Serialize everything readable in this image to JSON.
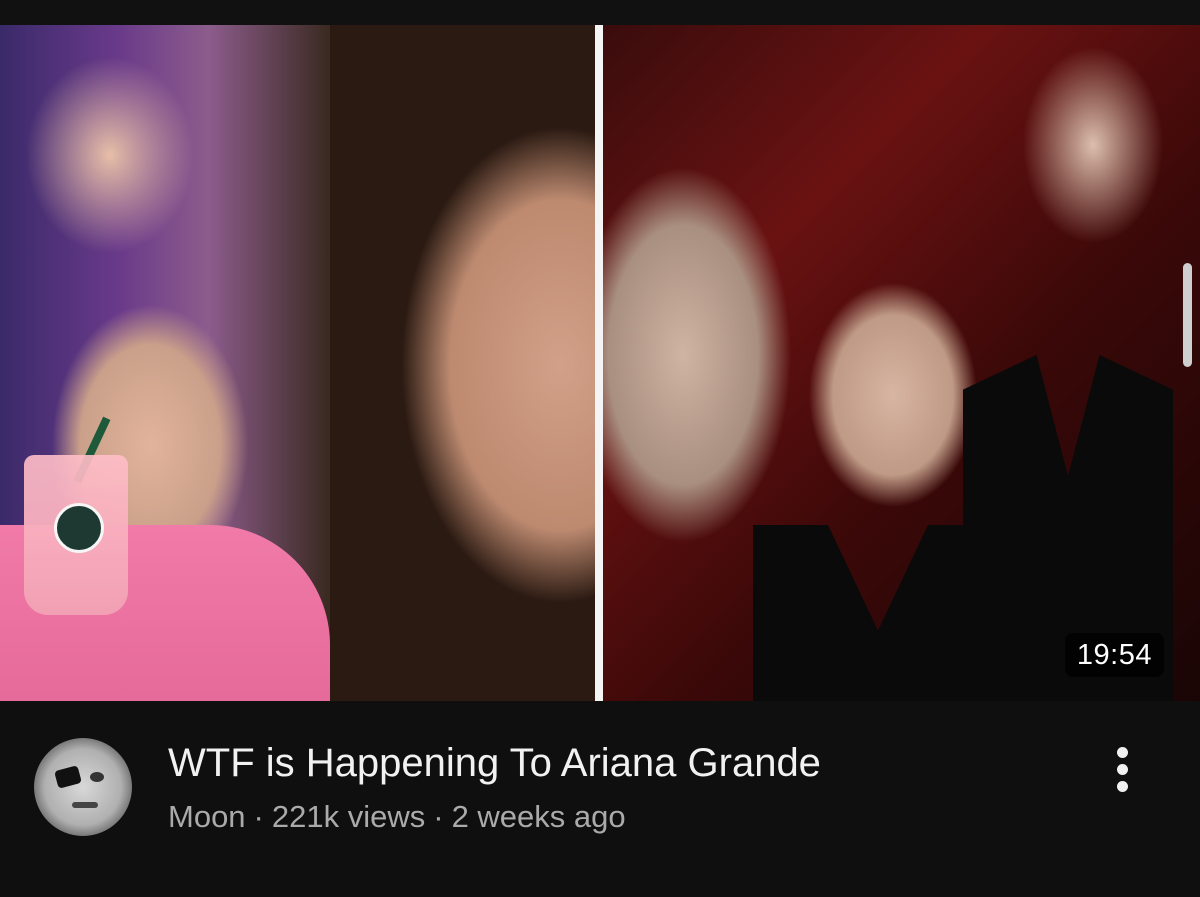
{
  "video": {
    "title": "WTF is Happening To Ariana Grande",
    "channel": "Moon",
    "views": "221k views",
    "age": "2 weeks ago",
    "separator": "·",
    "duration": "19:54"
  },
  "icons": {
    "more": "more-vertical-icon",
    "avatar": "channel-avatar"
  },
  "colors": {
    "background": "#0f0f0f",
    "title": "#f1f1f1",
    "meta": "#aaaaaa"
  }
}
